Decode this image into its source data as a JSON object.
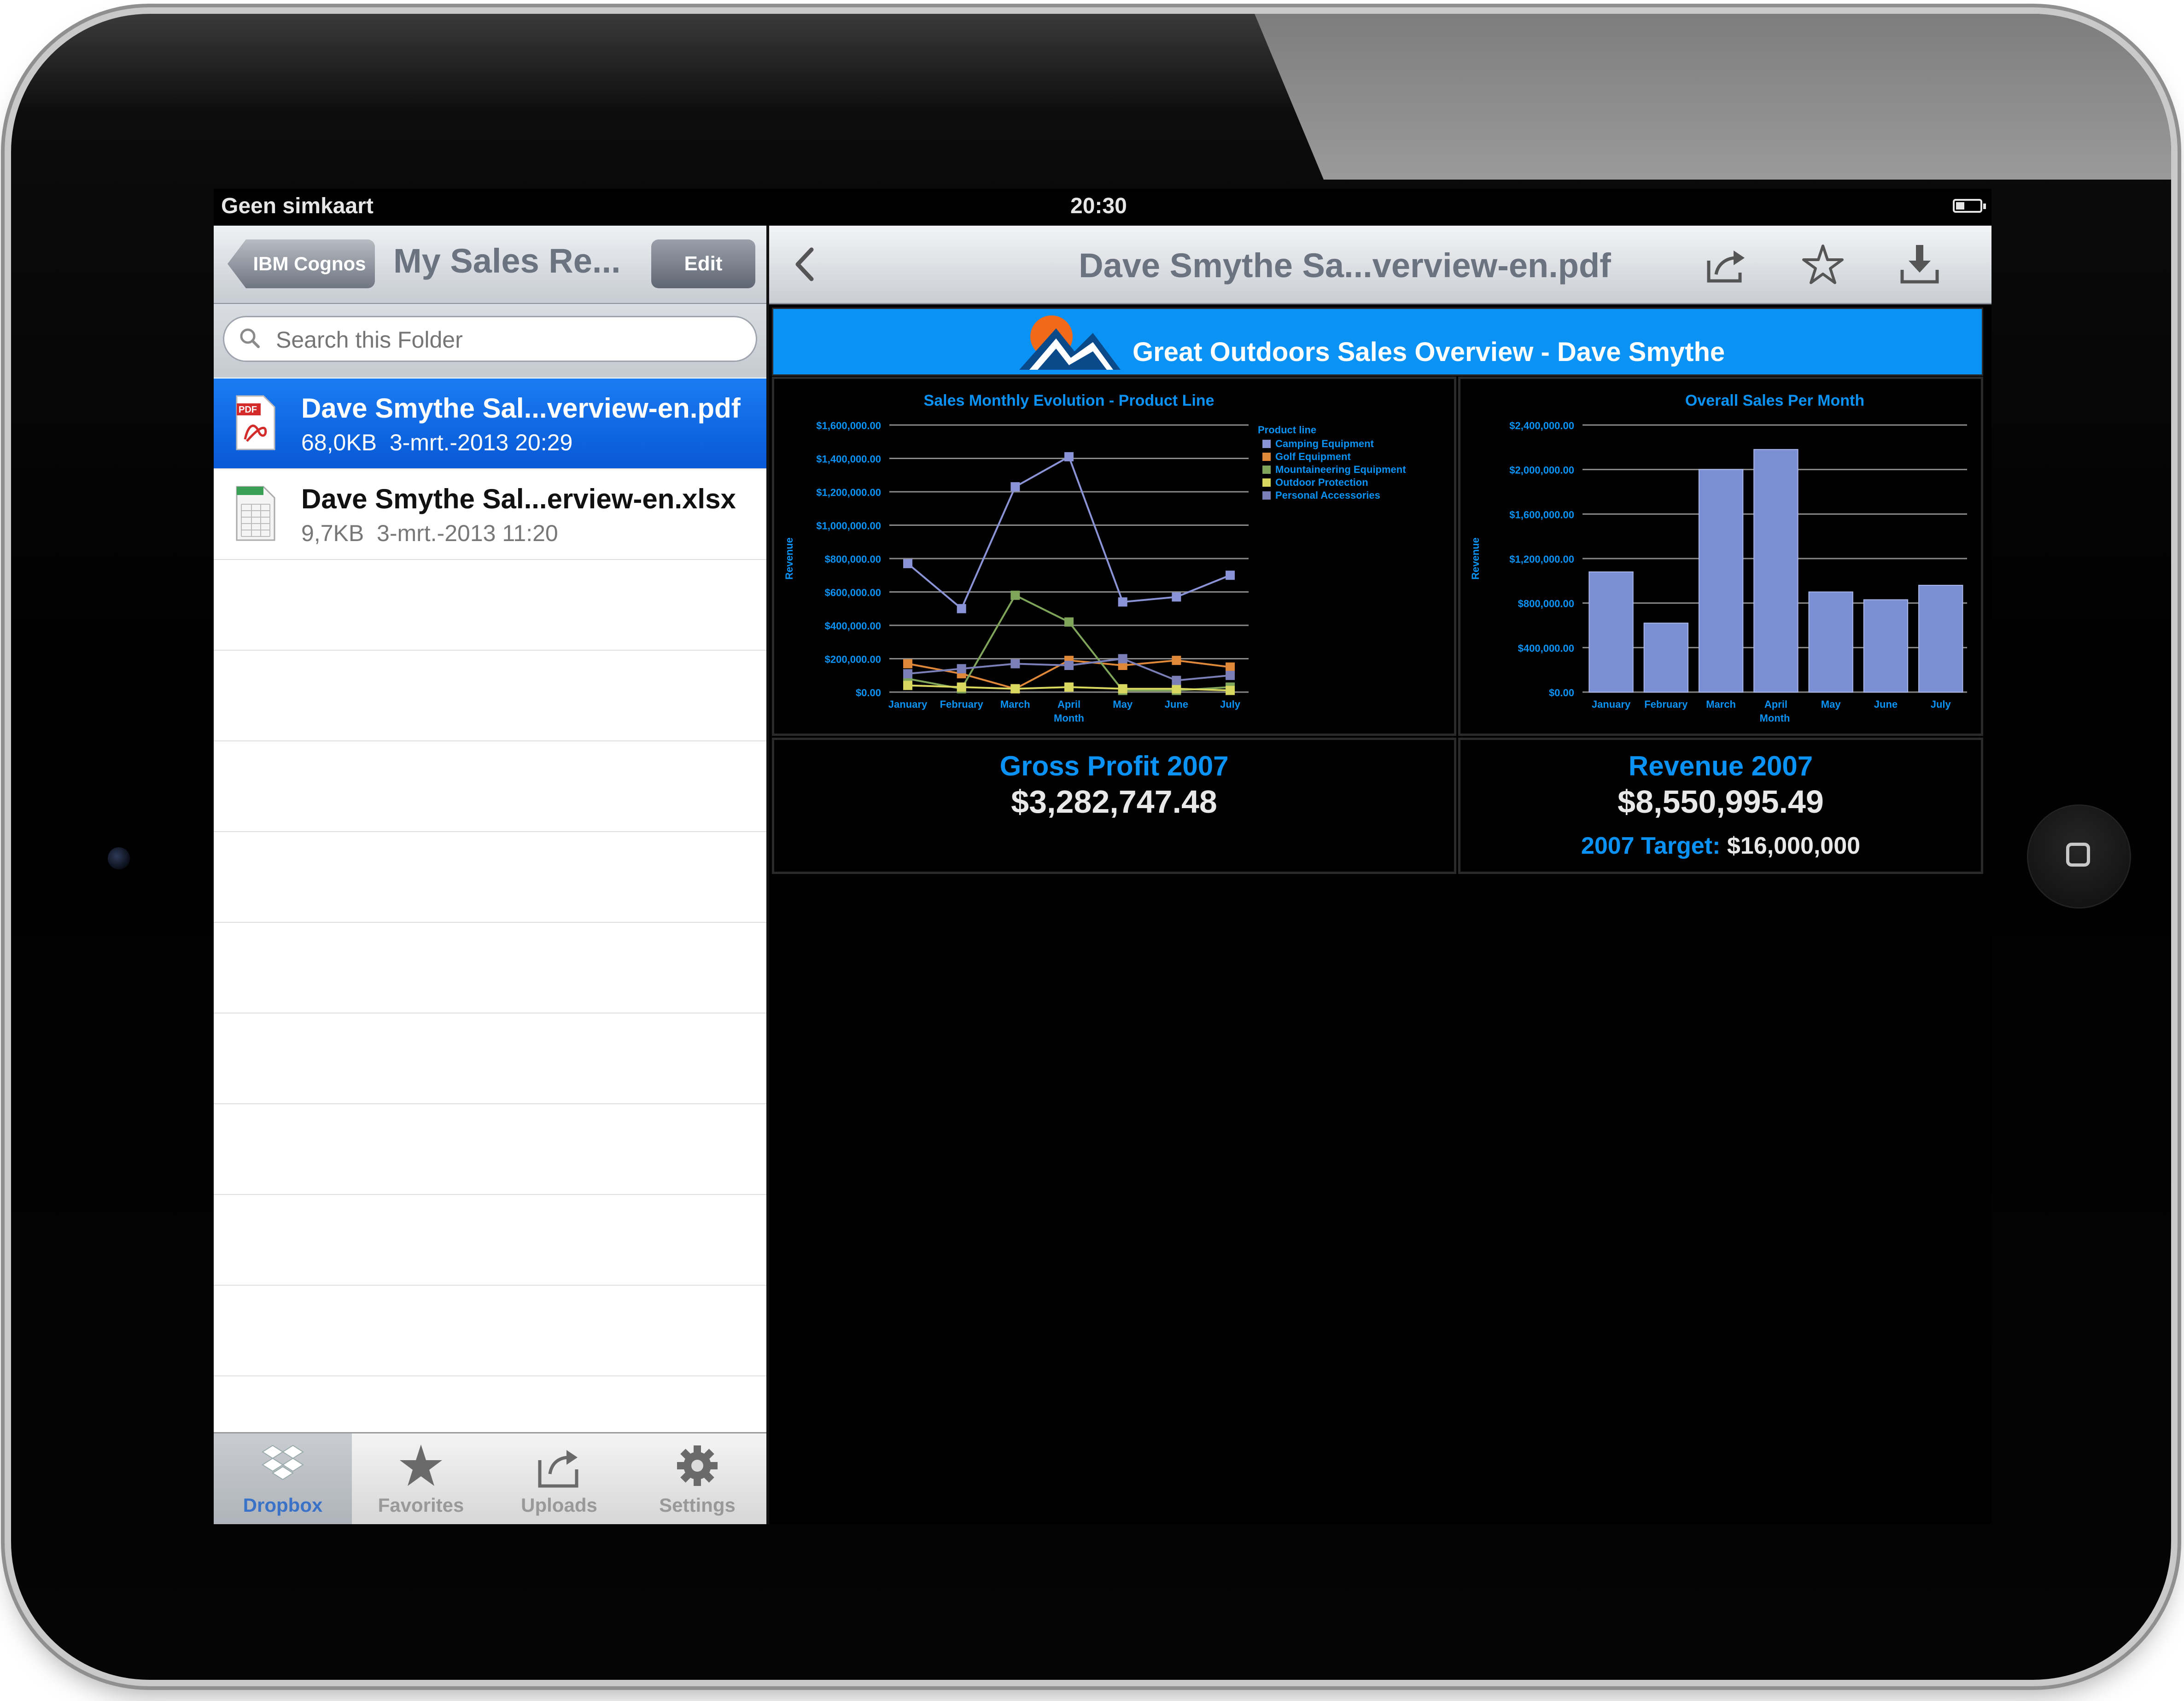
{
  "status_bar": {
    "carrier": "Geen simkaart",
    "time": "20:30"
  },
  "left_pane": {
    "back_label": "IBM Cognos",
    "title": "My Sales Re...",
    "edit_label": "Edit",
    "search_placeholder": "Search this Folder",
    "files": [
      {
        "name": "Dave Smythe Sal...verview-en.pdf",
        "size": "68,0KB",
        "date": "3-mrt.-2013 20:29",
        "type": "pdf",
        "selected": true
      },
      {
        "name": "Dave Smythe Sal...erview-en.xlsx",
        "size": "9,7KB",
        "date": "3-mrt.-2013 11:20",
        "type": "xlsx",
        "selected": false
      }
    ],
    "tabs": [
      {
        "label": "Dropbox",
        "icon": "dropbox-icon",
        "active": true
      },
      {
        "label": "Favorites",
        "icon": "star-icon",
        "active": false
      },
      {
        "label": "Uploads",
        "icon": "upload-icon",
        "active": false
      },
      {
        "label": "Settings",
        "icon": "gear-icon",
        "active": false
      }
    ]
  },
  "right_pane": {
    "title": "Dave Smythe Sa...verview-en.pdf",
    "icons": [
      "back-chevron-icon",
      "share-icon",
      "favorite-star-icon",
      "download-icon"
    ]
  },
  "report": {
    "title": "Great Outdoors Sales Overview - Dave Smythe",
    "gross_profit": {
      "label": "Gross Profit 2007",
      "value": "$3,282,747.48"
    },
    "revenue": {
      "label": "Revenue 2007",
      "value": "$8,550,995.49",
      "target_label": "2007 Target:",
      "target_value": "$16,000,000"
    }
  },
  "colors": {
    "accent_blue": "#0a93f5",
    "selection_blue": "#0f6de6",
    "bar_fill": "#7b8fd4"
  },
  "chart_data": [
    {
      "type": "line",
      "title": "Sales Monthly Evolution - Product Line",
      "xlabel": "Month",
      "ylabel": "Revenue",
      "legend_title": "Product line",
      "legend_position": "right",
      "categories": [
        "January",
        "February",
        "March",
        "April",
        "May",
        "June",
        "July"
      ],
      "y_ticks": [
        "$0.00",
        "$200,000.00",
        "$400,000.00",
        "$600,000.00",
        "$800,000.00",
        "$1,000,000.00",
        "$1,200,000.00",
        "$1,400,000.00",
        "$1,600,000.00"
      ],
      "ylim": [
        0,
        1600000
      ],
      "grid": true,
      "series": [
        {
          "name": "Camping Equipment",
          "color": "#8a93d6",
          "values": [
            770000,
            500000,
            1230000,
            1410000,
            540000,
            570000,
            700000
          ]
        },
        {
          "name": "Golf Equipment",
          "color": "#e0883a",
          "values": [
            170000,
            110000,
            20000,
            190000,
            160000,
            190000,
            150000
          ]
        },
        {
          "name": "Mountaineering Equipment",
          "color": "#7fa55a",
          "values": [
            80000,
            20000,
            580000,
            420000,
            10000,
            10000,
            30000
          ]
        },
        {
          "name": "Outdoor Protection",
          "color": "#d8d860",
          "values": [
            40000,
            30000,
            20000,
            30000,
            20000,
            20000,
            10000
          ]
        },
        {
          "name": "Personal Accessories",
          "color": "#7a7fb8",
          "values": [
            110000,
            140000,
            170000,
            160000,
            200000,
            70000,
            100000
          ]
        }
      ]
    },
    {
      "type": "bar",
      "title": "Overall Sales Per Month",
      "xlabel": "Month",
      "ylabel": "Revenue",
      "categories": [
        "January",
        "February",
        "March",
        "April",
        "May",
        "June",
        "July"
      ],
      "values": [
        1080000,
        620000,
        2000000,
        2180000,
        900000,
        830000,
        960000
      ],
      "y_ticks": [
        "$0.00",
        "$400,000.00",
        "$800,000.00",
        "$1,200,000.00",
        "$1,600,000.00",
        "$2,000,000.00",
        "$2,400,000.00"
      ],
      "ylim": [
        0,
        2400000
      ],
      "grid": true
    }
  ]
}
